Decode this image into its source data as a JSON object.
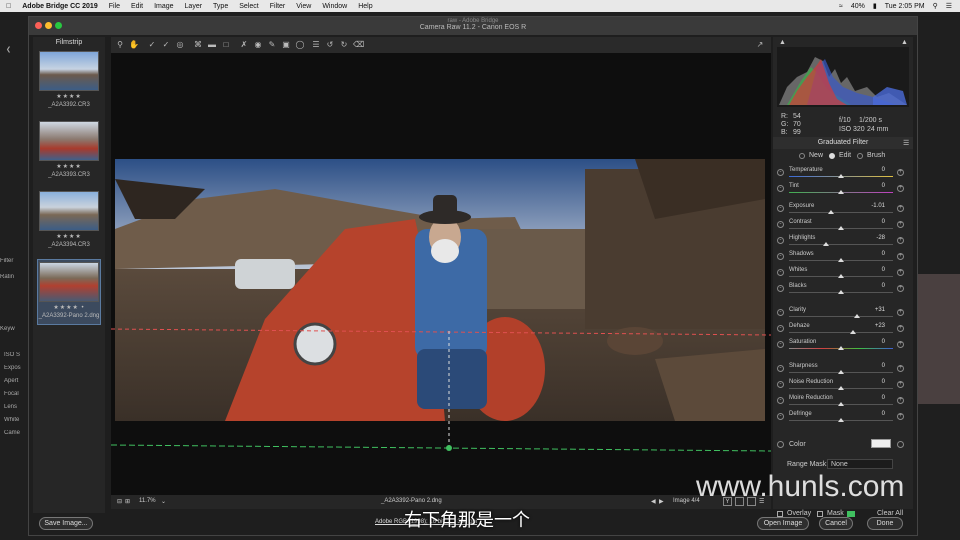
{
  "menubar": {
    "app": "Adobe Bridge CC 2019",
    "items": [
      "File",
      "Edit",
      "Image",
      "Layer",
      "Type",
      "Select",
      "Filter",
      "View",
      "Window",
      "Help"
    ],
    "battery": "40%",
    "clock": "Tue 2:05 PM"
  },
  "window": {
    "title_path": "raw - Adobe Bridge",
    "title": "Camera Raw 11.2  -  Canon EOS R"
  },
  "filmstrip": {
    "header": "Filmstrip",
    "items": [
      {
        "name": "_A2A3392.CR3",
        "stars": "★★★★"
      },
      {
        "name": "_A2A3393.CR3",
        "stars": "★★★★"
      },
      {
        "name": "_A2A3394.CR3",
        "stars": "★★★★"
      },
      {
        "name": "_A2A3392-Pano 2.dng",
        "stars": "★★★★ •"
      }
    ]
  },
  "bridge_left": {
    "filter": "Filter",
    "ratings": "Ratin",
    "keywords": "Keyw",
    "meta": [
      "ISO S",
      "Expos",
      "Apert",
      "Focal",
      "Lens",
      "White",
      "Came"
    ]
  },
  "histogram": {
    "r_label": "R:",
    "r": "54",
    "g_label": "G:",
    "g": "70",
    "b_label": "B:",
    "b": "99",
    "aperture": "f/10",
    "shutter": "1/200 s",
    "iso": "ISO 320",
    "focal": "24 mm"
  },
  "panel": {
    "title": "Graduated Filter",
    "modes": [
      "New",
      "Edit",
      "Brush"
    ],
    "sliders": [
      {
        "label": "Temperature",
        "value": "0",
        "pos": 0.5
      },
      {
        "label": "Tint",
        "value": "0",
        "pos": 0.5
      },
      {
        "label": "Exposure",
        "value": "-1.01",
        "pos": 0.4
      },
      {
        "label": "Contrast",
        "value": "0",
        "pos": 0.5
      },
      {
        "label": "Highlights",
        "value": "-28",
        "pos": 0.36
      },
      {
        "label": "Shadows",
        "value": "0",
        "pos": 0.5
      },
      {
        "label": "Whites",
        "value": "0",
        "pos": 0.5
      },
      {
        "label": "Blacks",
        "value": "0",
        "pos": 0.5
      },
      {
        "label": "Clarity",
        "value": "+31",
        "pos": 0.655
      },
      {
        "label": "Dehaze",
        "value": "+23",
        "pos": 0.615
      },
      {
        "label": "Saturation",
        "value": "0",
        "pos": 0.5
      },
      {
        "label": "Sharpness",
        "value": "0",
        "pos": 0.5
      },
      {
        "label": "Noise Reduction",
        "value": "0",
        "pos": 0.5
      },
      {
        "label": "Moire Reduction",
        "value": "0",
        "pos": 0.5
      },
      {
        "label": "Defringe",
        "value": "0",
        "pos": 0.5
      }
    ],
    "color_label": "Color",
    "range_mask_label": "Range Mask:",
    "range_mask_value": "None",
    "overlay": "Overlay",
    "mask": "Mask",
    "clear_all": "Clear All"
  },
  "bottombar": {
    "zoom": "11.7%",
    "filename": "_A2A3392-Pano 2.dng",
    "image_count": "Image 4/4"
  },
  "footer": {
    "save": "Save Image...",
    "workflow": "Adobe RGB (1998); 16 bit; 7... 300 ppi",
    "open": "Open Image",
    "cancel": "Cancel",
    "done": "Done"
  },
  "overlay_text": {
    "watermark": "www.hunls.com",
    "subtitle": "右下角那是一个"
  }
}
